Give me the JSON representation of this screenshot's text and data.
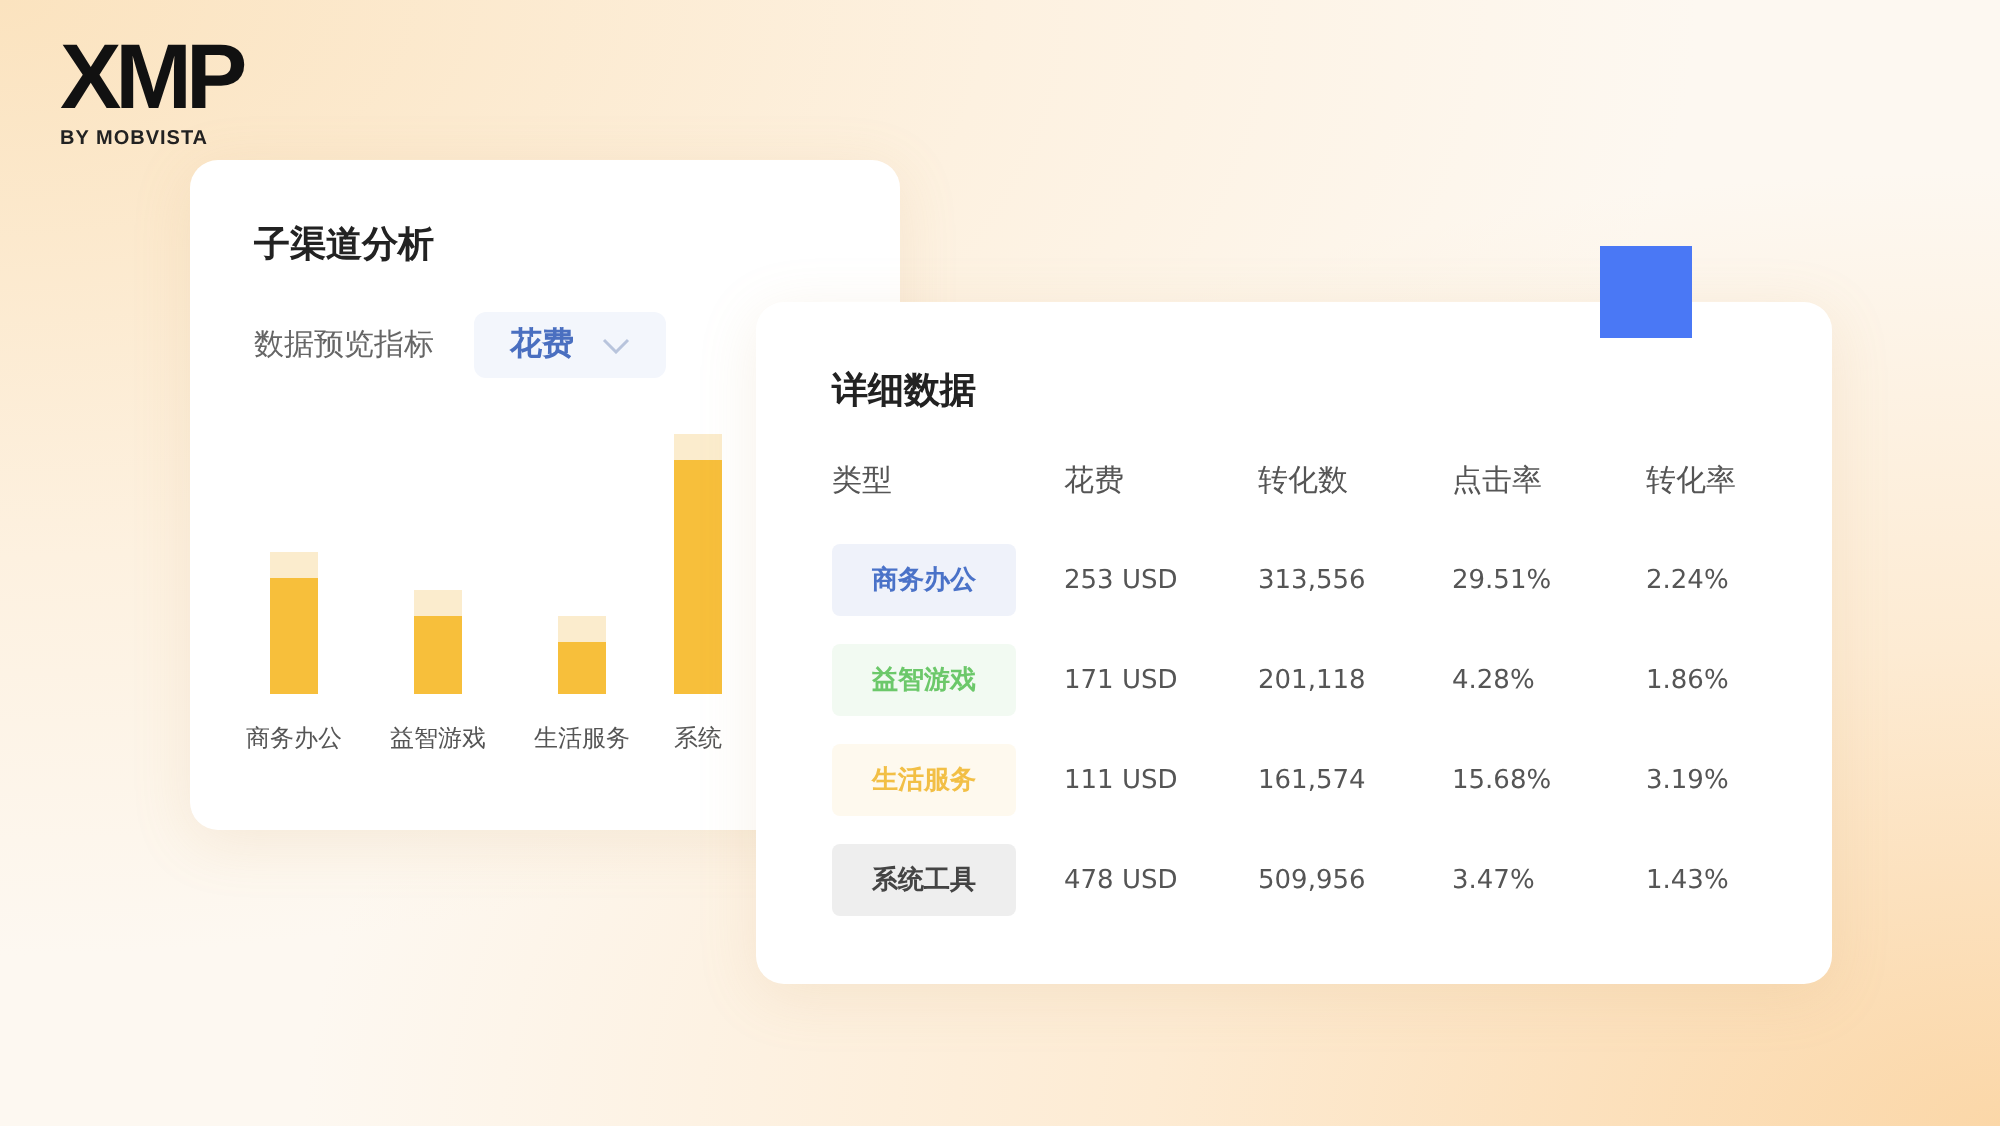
{
  "logo": {
    "mark": "XMP",
    "tagline": "BY MOBVISTA"
  },
  "channel_card": {
    "title": "子渠道分析",
    "metric_label": "数据预览指标",
    "metric_dropdown": {
      "value": "花费"
    },
    "chart_labels": [
      "商务办公",
      "益智游戏",
      "生活服务",
      "系统"
    ]
  },
  "detail_card": {
    "title": "详细数据",
    "columns": [
      "类型",
      "花费",
      "转化数",
      "点击率",
      "转化率"
    ],
    "rows": [
      {
        "color": "#4a72c8",
        "cells": [
          "商务办公",
          "253 USD",
          "313,556",
          "29.51%",
          "2.24%"
        ]
      },
      {
        "color": "#6cc86a",
        "cells": [
          "益智游戏",
          "171 USD",
          "201,118",
          "4.28%",
          "1.86%"
        ]
      },
      {
        "color": "#f2bf45",
        "cells": [
          "生活服务",
          "111 USD",
          "161,574",
          "15.68%",
          "3.19%"
        ]
      },
      {
        "color": "#444444",
        "cells": [
          "系统工具",
          "478 USD",
          "509,956",
          "3.47%",
          "1.43%"
        ]
      }
    ]
  }
}
